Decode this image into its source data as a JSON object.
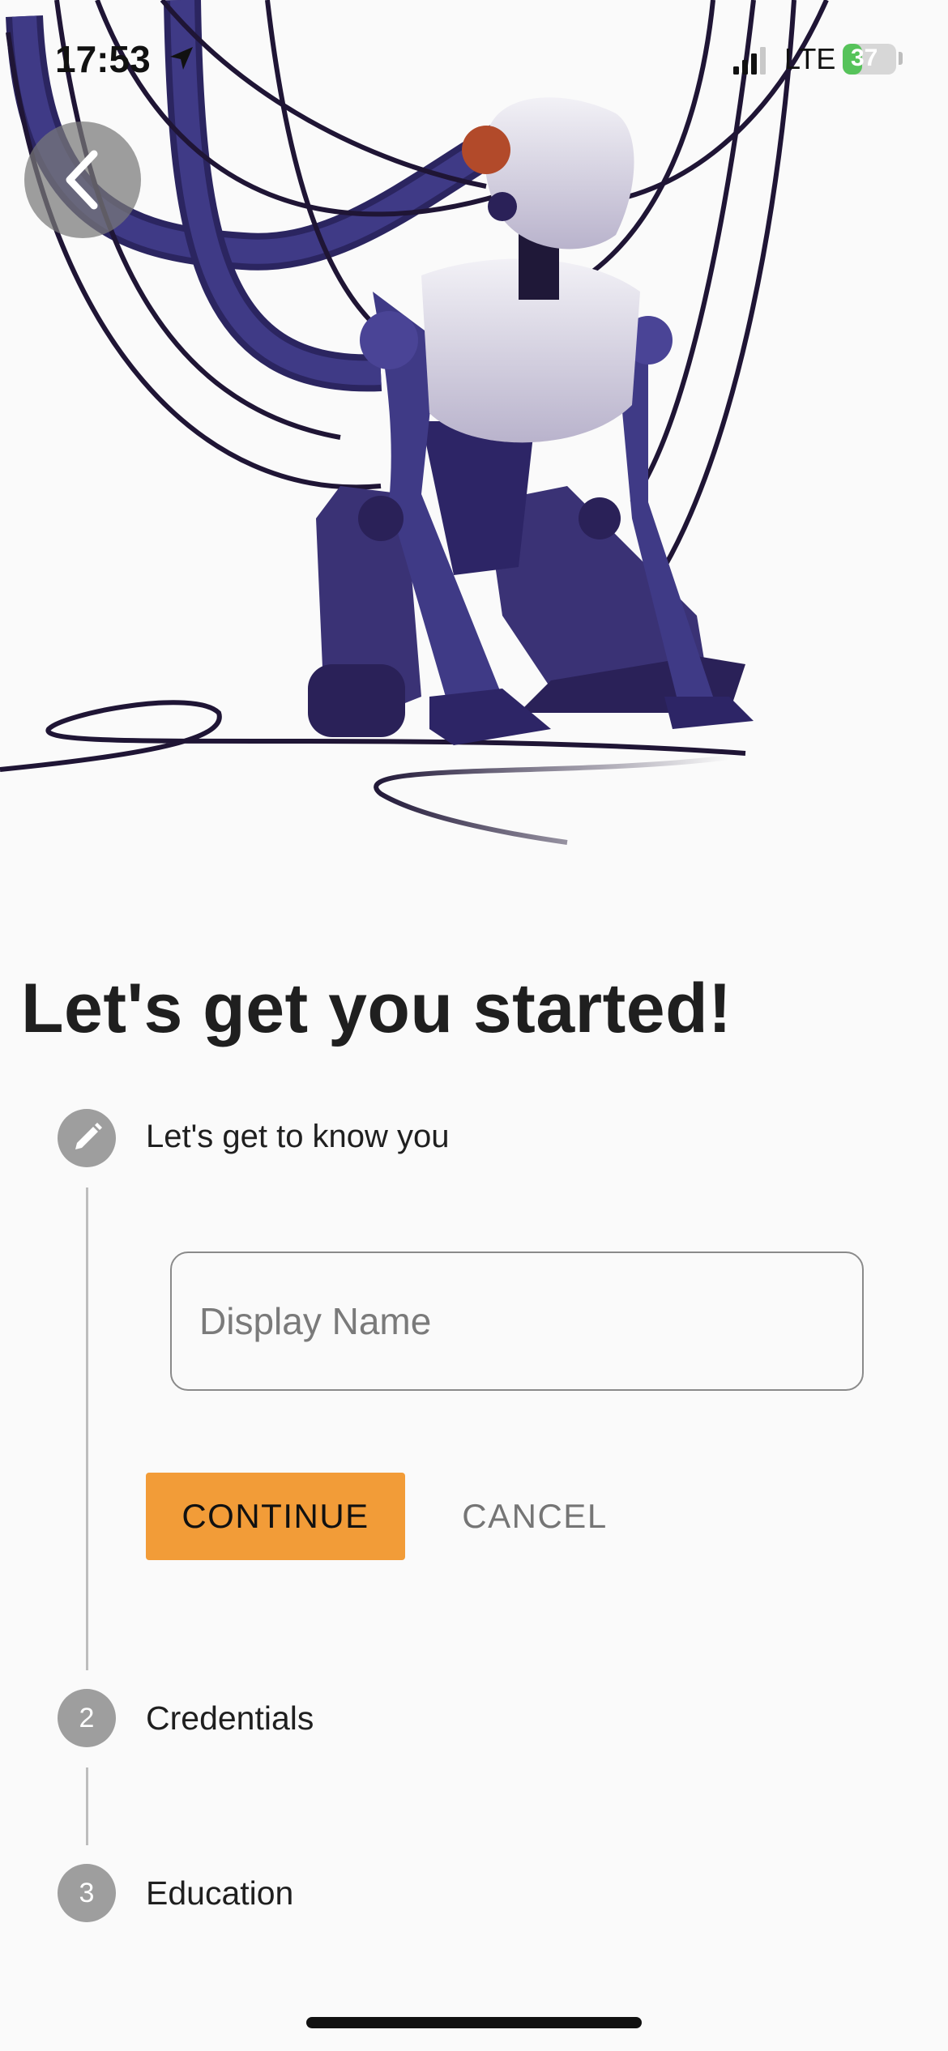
{
  "status_bar": {
    "time": "17:53",
    "network": "LTE",
    "battery_percent": 37,
    "battery_label": "37"
  },
  "icons": {
    "back": "chevron-left-icon",
    "location": "location-arrow-icon",
    "edit": "pencil-icon"
  },
  "colors": {
    "accent": "#f29c38",
    "step_inactive": "#9e9e9e",
    "battery_green": "#56c35a",
    "robot_navy": "#3a3275"
  },
  "page": {
    "title": "Let's get you started!"
  },
  "stepper": {
    "steps": [
      {
        "number": "",
        "label": "Let's get to know you",
        "state": "editing"
      },
      {
        "number": "2",
        "label": "Credentials",
        "state": "pending"
      },
      {
        "number": "3",
        "label": "Education",
        "state": "pending"
      }
    ]
  },
  "form": {
    "display_name_placeholder": "Display Name",
    "display_name_value": "",
    "continue_label": "CONTINUE",
    "cancel_label": "CANCEL"
  }
}
